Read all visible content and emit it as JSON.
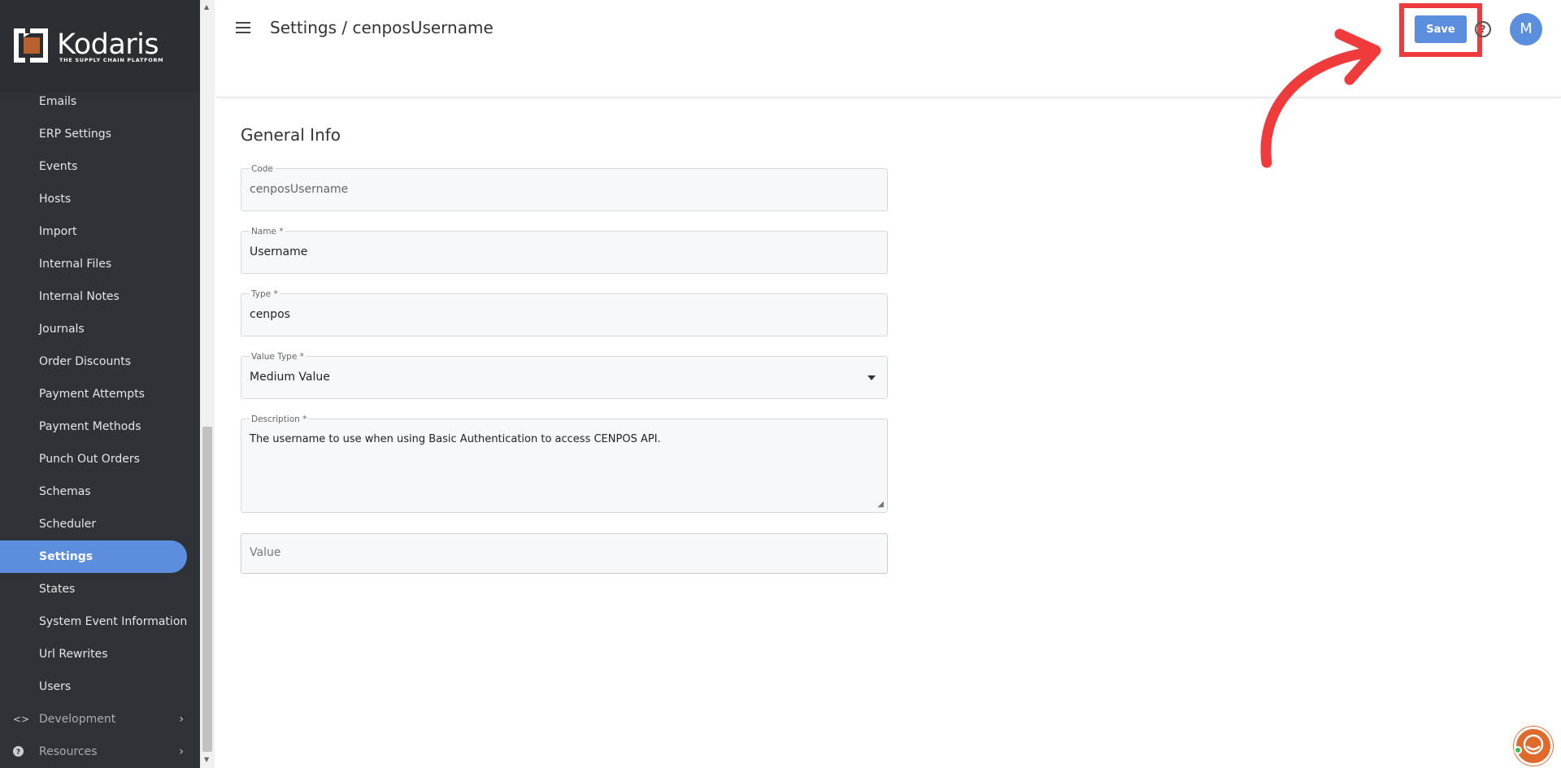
{
  "brand": {
    "name": "Kodaris",
    "tagline": "THE SUPPLY CHAIN PLATFORM",
    "color": "#b8612f"
  },
  "sidebar": {
    "items": [
      {
        "label": "Emails",
        "active": false
      },
      {
        "label": "ERP Settings",
        "active": false
      },
      {
        "label": "Events",
        "active": false
      },
      {
        "label": "Hosts",
        "active": false
      },
      {
        "label": "Import",
        "active": false
      },
      {
        "label": "Internal Files",
        "active": false
      },
      {
        "label": "Internal Notes",
        "active": false
      },
      {
        "label": "Journals",
        "active": false
      },
      {
        "label": "Order Discounts",
        "active": false
      },
      {
        "label": "Payment Attempts",
        "active": false
      },
      {
        "label": "Payment Methods",
        "active": false
      },
      {
        "label": "Punch Out Orders",
        "active": false
      },
      {
        "label": "Schemas",
        "active": false
      },
      {
        "label": "Scheduler",
        "active": false
      },
      {
        "label": "Settings",
        "active": true
      },
      {
        "label": "States",
        "active": false
      },
      {
        "label": "System Event Information",
        "active": false
      },
      {
        "label": "Url Rewrites",
        "active": false
      },
      {
        "label": "Users",
        "active": false
      }
    ],
    "sections": [
      {
        "label": "Development",
        "icon": "code-icon"
      },
      {
        "label": "Resources",
        "icon": "help-circle-icon"
      }
    ]
  },
  "header": {
    "title": "Settings / cenposUsername",
    "save_label": "Save",
    "help_symbol": "?",
    "avatar_initial": "M"
  },
  "form": {
    "section_title": "General Info",
    "code": {
      "label": "Code",
      "value": "cenposUsername"
    },
    "name": {
      "label": "Name *",
      "value": "Username"
    },
    "type": {
      "label": "Type *",
      "value": "cenpos"
    },
    "value_type": {
      "label": "Value Type *",
      "value": "Medium Value"
    },
    "description": {
      "label": "Description *",
      "value": "The username to use when using Basic Authentication to access CENPOS API."
    },
    "value": {
      "placeholder": "Value"
    }
  },
  "colors": {
    "accent": "#5b8fdd",
    "annotation": "#ef3b3b",
    "sidebar_bg": "#2f3237"
  }
}
